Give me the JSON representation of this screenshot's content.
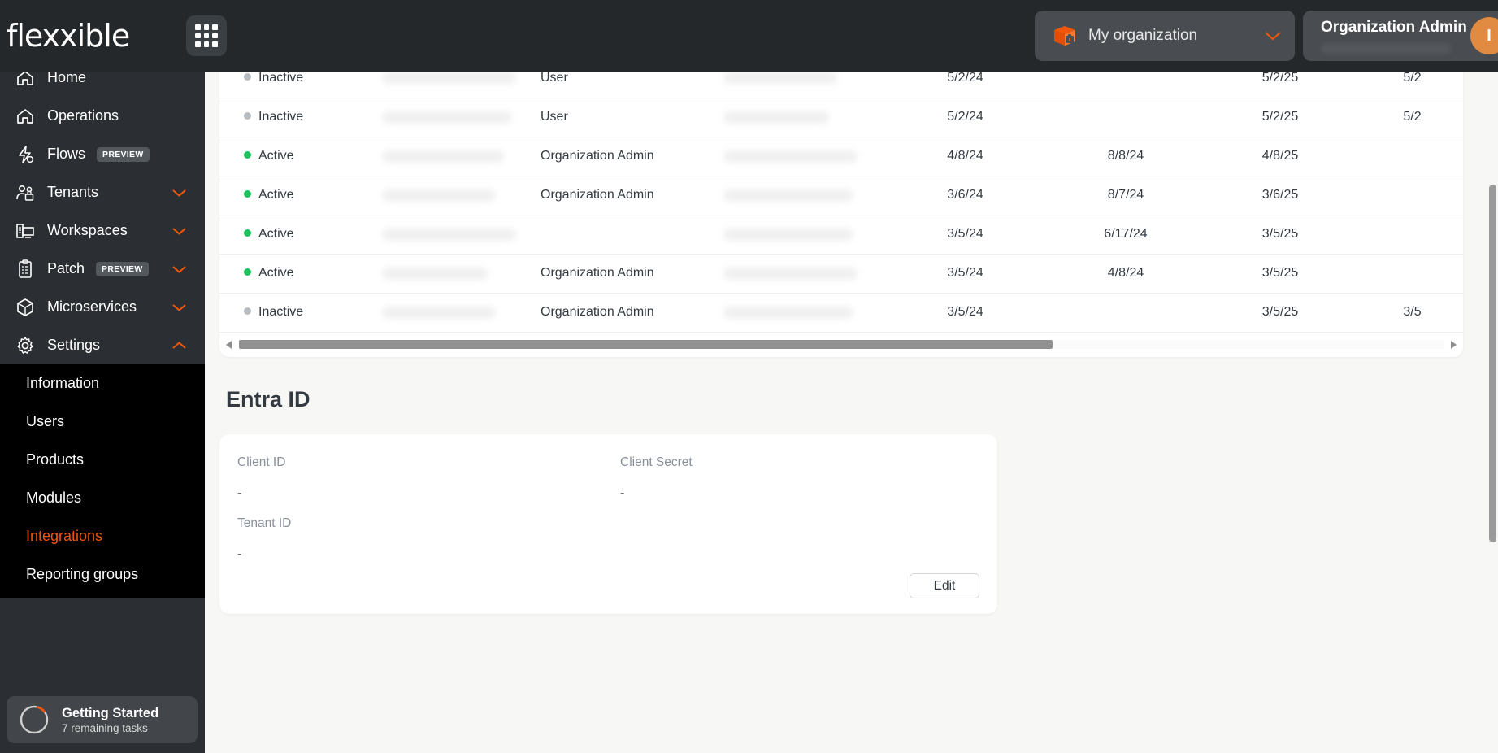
{
  "brand": {
    "name": "flexxible",
    "apps_icon": "grid-apps-icon"
  },
  "header": {
    "org_selector": {
      "icon": "package-box-icon",
      "label": "My organization",
      "chevron": "chevron-down-icon"
    },
    "user": {
      "role": "Organization Admin",
      "avatar_initial": "I"
    }
  },
  "sidebar": {
    "items": [
      {
        "label": "Home",
        "icon": "home-icon",
        "badge": null,
        "chevron": null
      },
      {
        "label": "Operations",
        "icon": "operations-home-icon",
        "badge": null,
        "chevron": null
      },
      {
        "label": "Flows",
        "icon": "flows-bolt-icon",
        "badge": "PREVIEW",
        "chevron": null
      },
      {
        "label": "Tenants",
        "icon": "tenants-users-icon",
        "badge": null,
        "chevron": "chevron-down-icon"
      },
      {
        "label": "Workspaces",
        "icon": "workspaces-monitor-icon",
        "badge": null,
        "chevron": "chevron-down-icon"
      },
      {
        "label": "Patch",
        "icon": "patch-clipboard-icon",
        "badge": "PREVIEW",
        "chevron": "chevron-down-icon"
      },
      {
        "label": "Microservices",
        "icon": "microservices-cube-icon",
        "badge": null,
        "chevron": "chevron-down-icon"
      },
      {
        "label": "Settings",
        "icon": "settings-gear-icon",
        "badge": null,
        "chevron": "chevron-up-icon"
      }
    ],
    "submenu": [
      {
        "label": "Information",
        "active": false
      },
      {
        "label": "Users",
        "active": false
      },
      {
        "label": "Products",
        "active": false
      },
      {
        "label": "Modules",
        "active": false
      },
      {
        "label": "Integrations",
        "active": true
      },
      {
        "label": "Reporting groups",
        "active": false
      }
    ],
    "getting_started": {
      "title": "Getting Started",
      "subtitle": "7 remaining tasks",
      "progress_percent": 12
    }
  },
  "users_table": {
    "rows": [
      {
        "status": "Inactive",
        "state": "inactive",
        "name": "",
        "role": "User",
        "extra": "",
        "d1": "5/2/24",
        "d2": "",
        "d3": "5/2/25",
        "d4": "5/2"
      },
      {
        "status": "Inactive",
        "state": "inactive",
        "name": "",
        "role": "User",
        "extra": "",
        "d1": "5/2/24",
        "d2": "",
        "d3": "5/2/25",
        "d4": "5/2"
      },
      {
        "status": "Active",
        "state": "active",
        "name": "",
        "role": "Organization Admin",
        "extra": "",
        "d1": "4/8/24",
        "d2": "8/8/24",
        "d3": "4/8/25",
        "d4": ""
      },
      {
        "status": "Active",
        "state": "active",
        "name": "",
        "role": "Organization Admin",
        "extra": "",
        "d1": "3/6/24",
        "d2": "8/7/24",
        "d3": "3/6/25",
        "d4": ""
      },
      {
        "status": "Active",
        "state": "active",
        "name": "",
        "role": "",
        "extra": "",
        "d1": "3/5/24",
        "d2": "6/17/24",
        "d3": "3/5/25",
        "d4": ""
      },
      {
        "status": "Active",
        "state": "active",
        "name": "",
        "role": "Organization Admin",
        "extra": "",
        "d1": "3/5/24",
        "d2": "4/8/24",
        "d3": "3/5/25",
        "d4": ""
      },
      {
        "status": "Inactive",
        "state": "inactive",
        "name": "",
        "role": "Organization Admin",
        "extra": "",
        "d1": "3/5/24",
        "d2": "",
        "d3": "3/5/25",
        "d4": "3/5"
      }
    ]
  },
  "entra": {
    "title": "Entra ID",
    "fields": {
      "client_id_label": "Client ID",
      "client_id_value": "-",
      "client_secret_label": "Client Secret",
      "client_secret_value": "-",
      "tenant_id_label": "Tenant ID",
      "tenant_id_value": "-"
    },
    "edit_label": "Edit"
  },
  "colors": {
    "accent_orange": "#f2560a",
    "avatar_orange": "#e08a42",
    "status_active": "#1fc25c",
    "status_inactive": "#b7bcc0",
    "topbar_bg": "#24282b",
    "sidebar_bg": "#2b2f33",
    "submenu_bg": "#000000"
  }
}
